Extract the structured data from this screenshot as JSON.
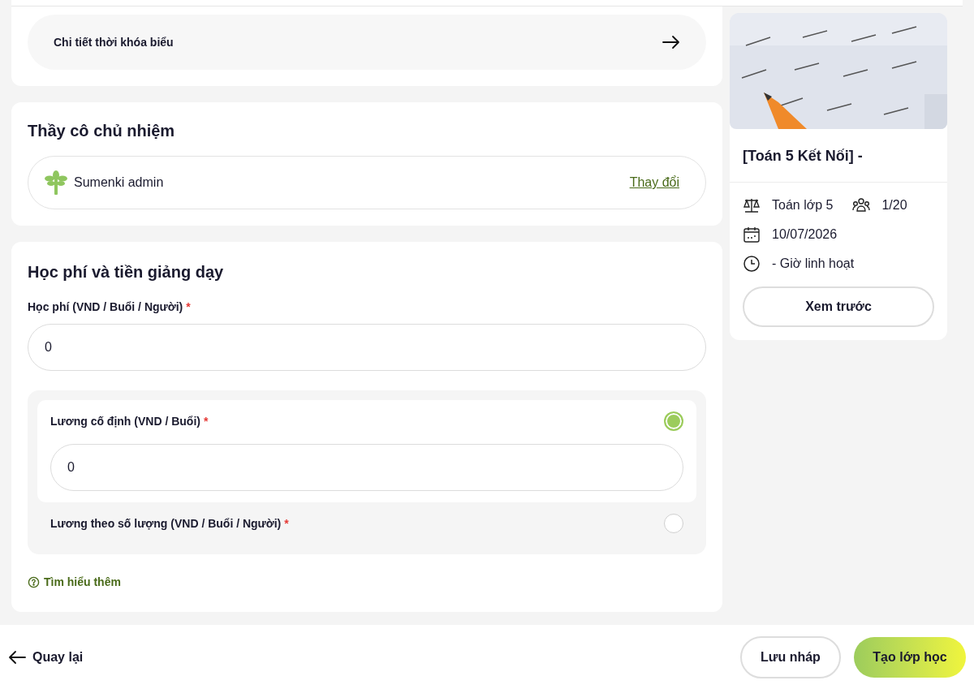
{
  "schedule_link": {
    "label": "Chi tiết thời khóa biểu"
  },
  "homeroom": {
    "title": "Thầy cô chủ nhiệm",
    "teacher": "Sumenki admin",
    "change_link": "Thay đổi"
  },
  "fees": {
    "title": "Học phí và tiền giảng dạy",
    "tuition": {
      "label": "Học phí (VND / Buổi / Người)",
      "required_mark": "*",
      "value": "0"
    },
    "salary_options": [
      {
        "label": "Lương cố định (VND / Buổi)",
        "required_mark": "*",
        "selected": true,
        "value": "0"
      },
      {
        "label": "Lương theo số lượng (VND / Buổi / Người)",
        "required_mark": "*",
        "selected": false
      }
    ],
    "learn_more": "Tìm hiểu thêm"
  },
  "preview_card": {
    "title": "[Toán 5 Kết Nối] -",
    "subject": "Toán lớp 5",
    "students": "1/20",
    "date": "10/07/2026",
    "time": "- Giờ linh hoạt",
    "preview_button": "Xem trước"
  },
  "footer": {
    "back": "Quay lại",
    "save_draft": "Lưu nháp",
    "create": "Tạo lớp học"
  }
}
